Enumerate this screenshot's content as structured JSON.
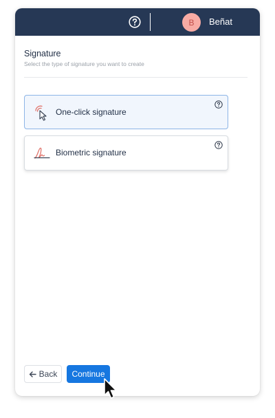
{
  "header": {
    "help_icon": "question-circle-icon",
    "user_initial": "B",
    "user_name": "Beñat",
    "background_color": "#263855",
    "avatar_color": "#f8aba4"
  },
  "main": {
    "title": "Signature",
    "subtitle": "Select the type of signature you want to create",
    "options": [
      {
        "label": "One-click signature",
        "icon": "click-pointer-icon",
        "help_icon": "question-circle-icon",
        "selected": true
      },
      {
        "label": "Biometric signature",
        "icon": "handwritten-signature-icon",
        "help_icon": "question-circle-icon",
        "selected": false
      }
    ]
  },
  "footer": {
    "back_label": "Back",
    "back_icon": "arrow-left-icon",
    "continue_label": "Continue",
    "accent_color": "#1677e0"
  }
}
